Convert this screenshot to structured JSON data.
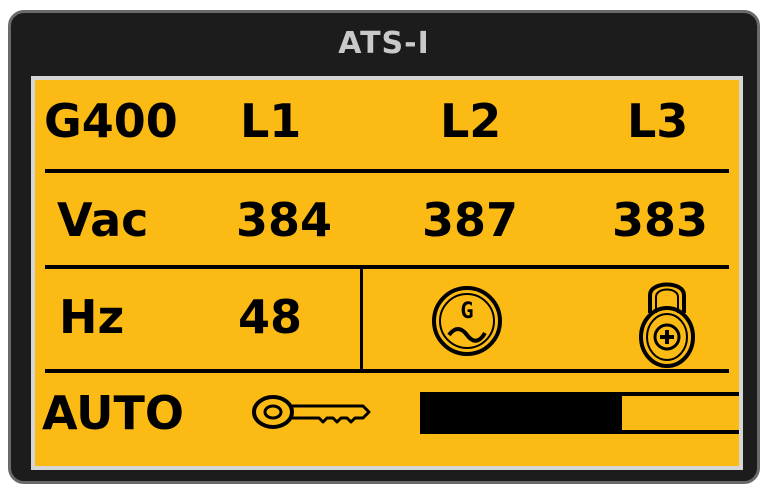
{
  "title": "ATS-I",
  "header_row": {
    "source": "G400",
    "phase1": "L1",
    "phase2": "L2",
    "phase3": "L3"
  },
  "voltage_row": {
    "label": "Vac",
    "l1": "384",
    "l2": "387",
    "l3": "383"
  },
  "freq_row": {
    "label": "Hz",
    "value": "48",
    "generator_icon": "generator-icon",
    "generator_letter": "G",
    "lock_icon": "padlock-icon"
  },
  "mode_row": {
    "label": "AUTO",
    "key_icon": "key-icon",
    "progress": 0.63
  },
  "colors": {
    "lcd_background": "#fbbb14",
    "bezel": "#1c1c1c",
    "title_text": "#c9c9c9"
  }
}
